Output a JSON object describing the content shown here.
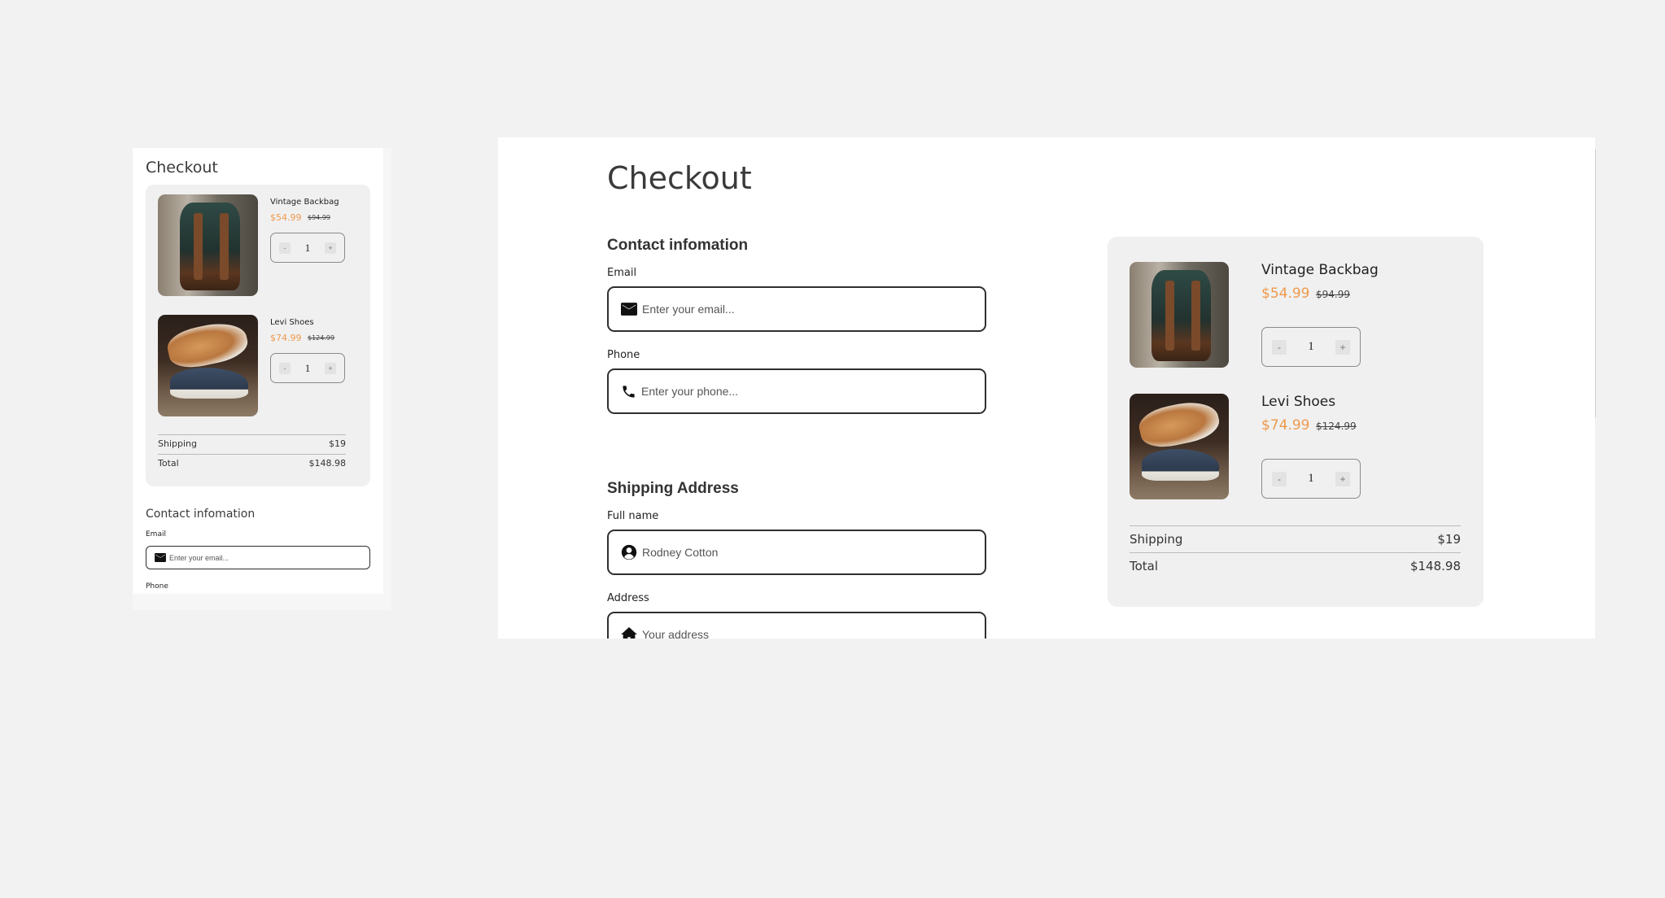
{
  "checkout": {
    "title": "Checkout",
    "contact": {
      "heading": "Contact infomation",
      "email_label": "Email",
      "email_placeholder": "Enter your email...",
      "phone_label": "Phone",
      "phone_placeholder": "Enter your phone..."
    },
    "shipping": {
      "heading": "Shipping Address",
      "fullname_label": "Full name",
      "fullname_placeholder": "Rodney Cotton",
      "address_label": "Address",
      "address_placeholder": "Your address"
    },
    "cart": {
      "items": [
        {
          "name": "Vintage Backbag",
          "price": "$54.99",
          "original_price": "$94.99",
          "qty": "1",
          "minus": "-",
          "plus": "+",
          "image_icon": "backpack-photo"
        },
        {
          "name": "Levi Shoes",
          "price": "$74.99",
          "original_price": "$124.99",
          "qty": "1",
          "minus": "-",
          "plus": "+",
          "image_icon": "shoes-photo"
        }
      ],
      "summary": {
        "shipping_label": "Shipping",
        "shipping_value": "$19",
        "total_label": "Total",
        "total_value": "$148.98"
      }
    },
    "icons": {
      "email": "envelope-icon",
      "phone": "phone-icon",
      "fullname": "user-circle-icon",
      "address": "home-icon"
    },
    "colors": {
      "sale_price": "#ee9a4e",
      "page_background": "#f2f2f2",
      "cart_background": "#f0f0f0"
    }
  }
}
